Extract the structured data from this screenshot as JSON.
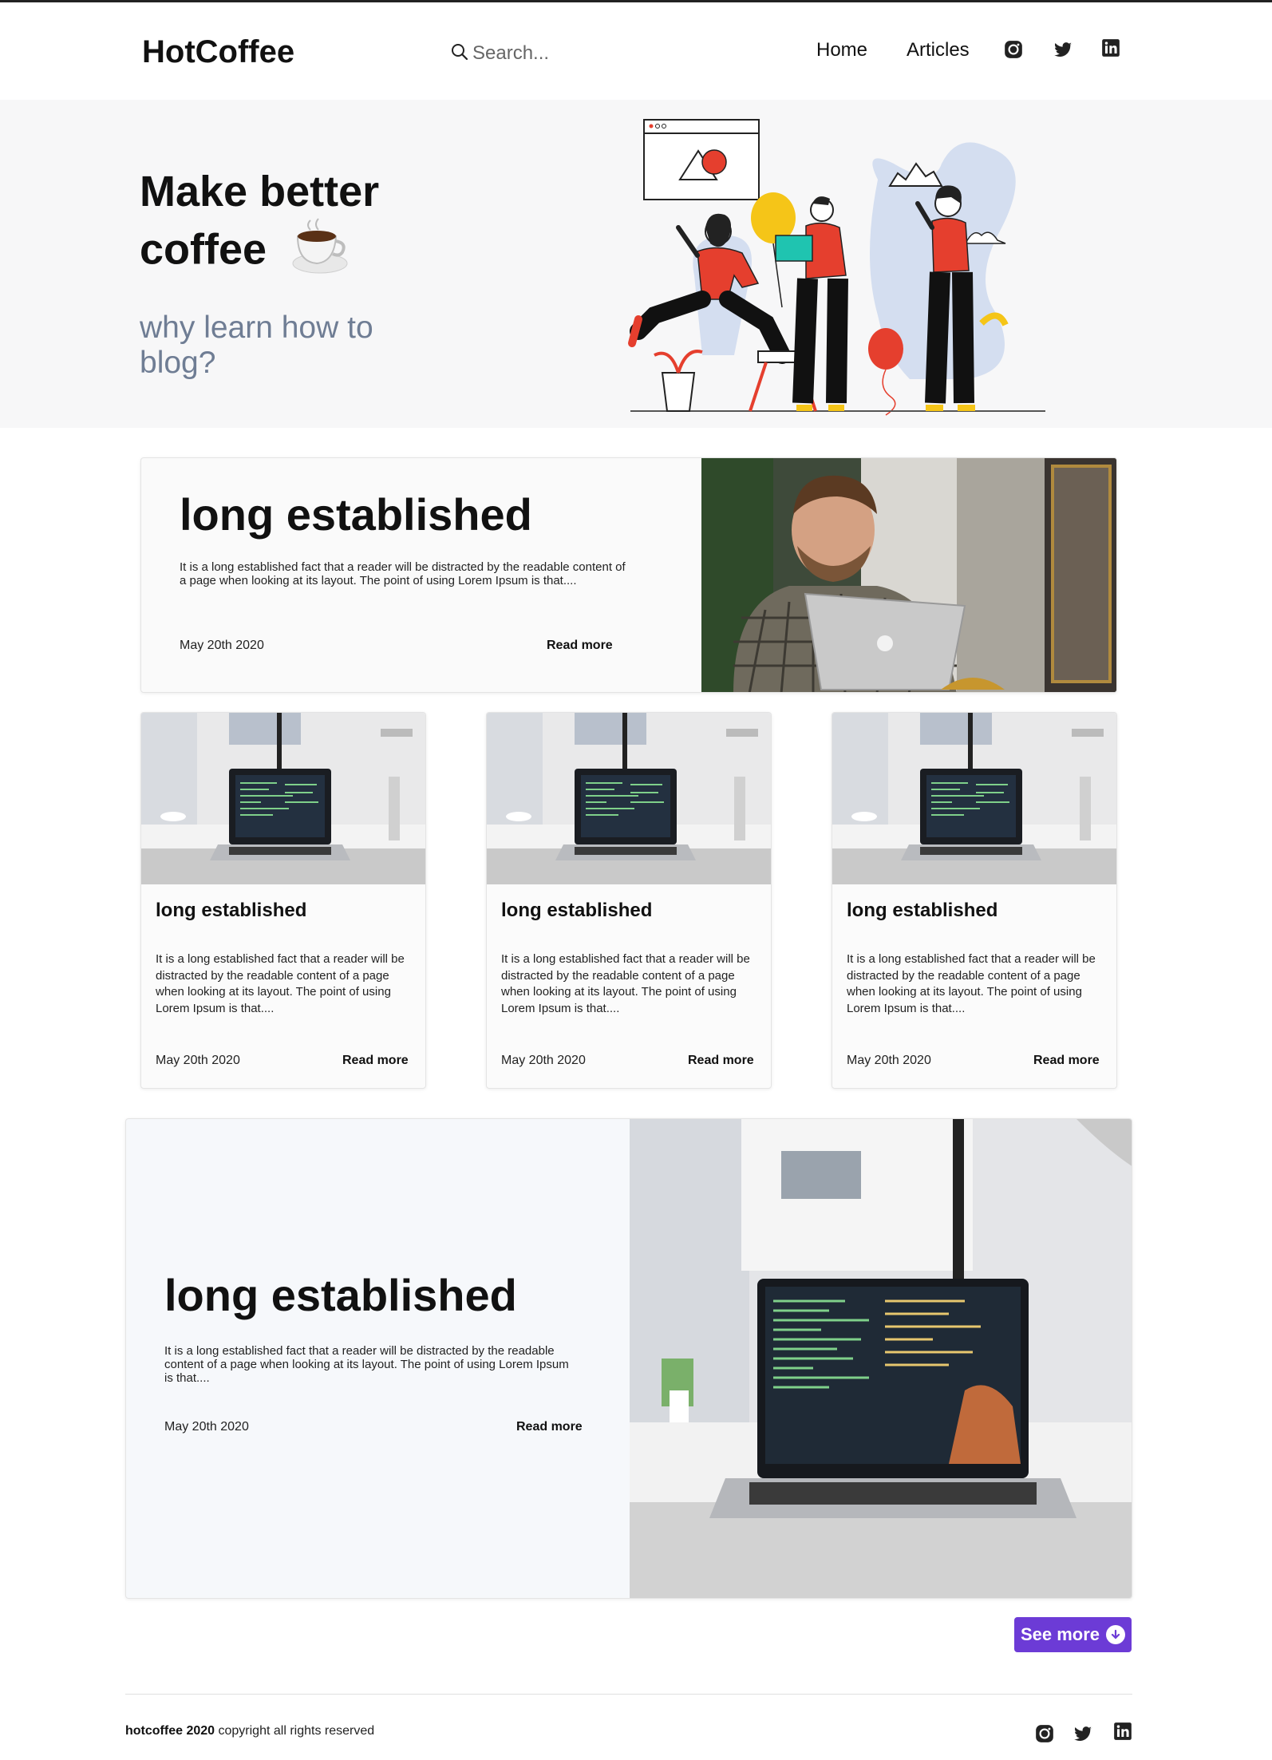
{
  "brand": {
    "name": "HotCoffee",
    "accent": "#6c3bd6",
    "subtitle_color": "#6f7d94"
  },
  "search": {
    "placeholder": "Search..."
  },
  "nav": {
    "home": "Home",
    "articles": "Articles"
  },
  "social": [
    "instagram-icon",
    "twitter-icon",
    "linkedin-icon"
  ],
  "hero": {
    "title_line1": "Make better",
    "title_line2": "coffee",
    "subtitle": "why learn how to blog?"
  },
  "featured": {
    "title": "long established",
    "body": "It is a long established fact that a reader will be distracted by the readable content of a page when looking at its layout. The point of using Lorem Ipsum is that....",
    "date": "May 20th 2020",
    "read_more": "Read more"
  },
  "cards": [
    {
      "title": "long established",
      "body": "It is a long established fact that a reader will be distracted by the readable content of a page when looking at its layout. The point of using Lorem Ipsum is that....",
      "date": "May 20th 2020",
      "read_more": "Read more"
    },
    {
      "title": "long established",
      "body": "It is a long established fact that a reader will be distracted by the readable content of a page when looking at its layout. The point of using Lorem Ipsum is that....",
      "date": "May 20th 2020",
      "read_more": "Read more"
    },
    {
      "title": "long established",
      "body": "It is a long established fact that a reader will be distracted by the readable content of a page when looking at its layout. The point of using Lorem Ipsum is that....",
      "date": "May 20th 2020",
      "read_more": "Read more"
    }
  ],
  "featured2": {
    "title": "long established",
    "body": "It is a long established fact that a reader will be distracted by the readable content of a page when looking at its layout. The point of using Lorem Ipsum is that....",
    "date": "May 20th 2020",
    "read_more": "Read more"
  },
  "see_more": "See more",
  "footer": {
    "brand": "hotcoffee 2020",
    "text": " copyright all rights reserved"
  }
}
